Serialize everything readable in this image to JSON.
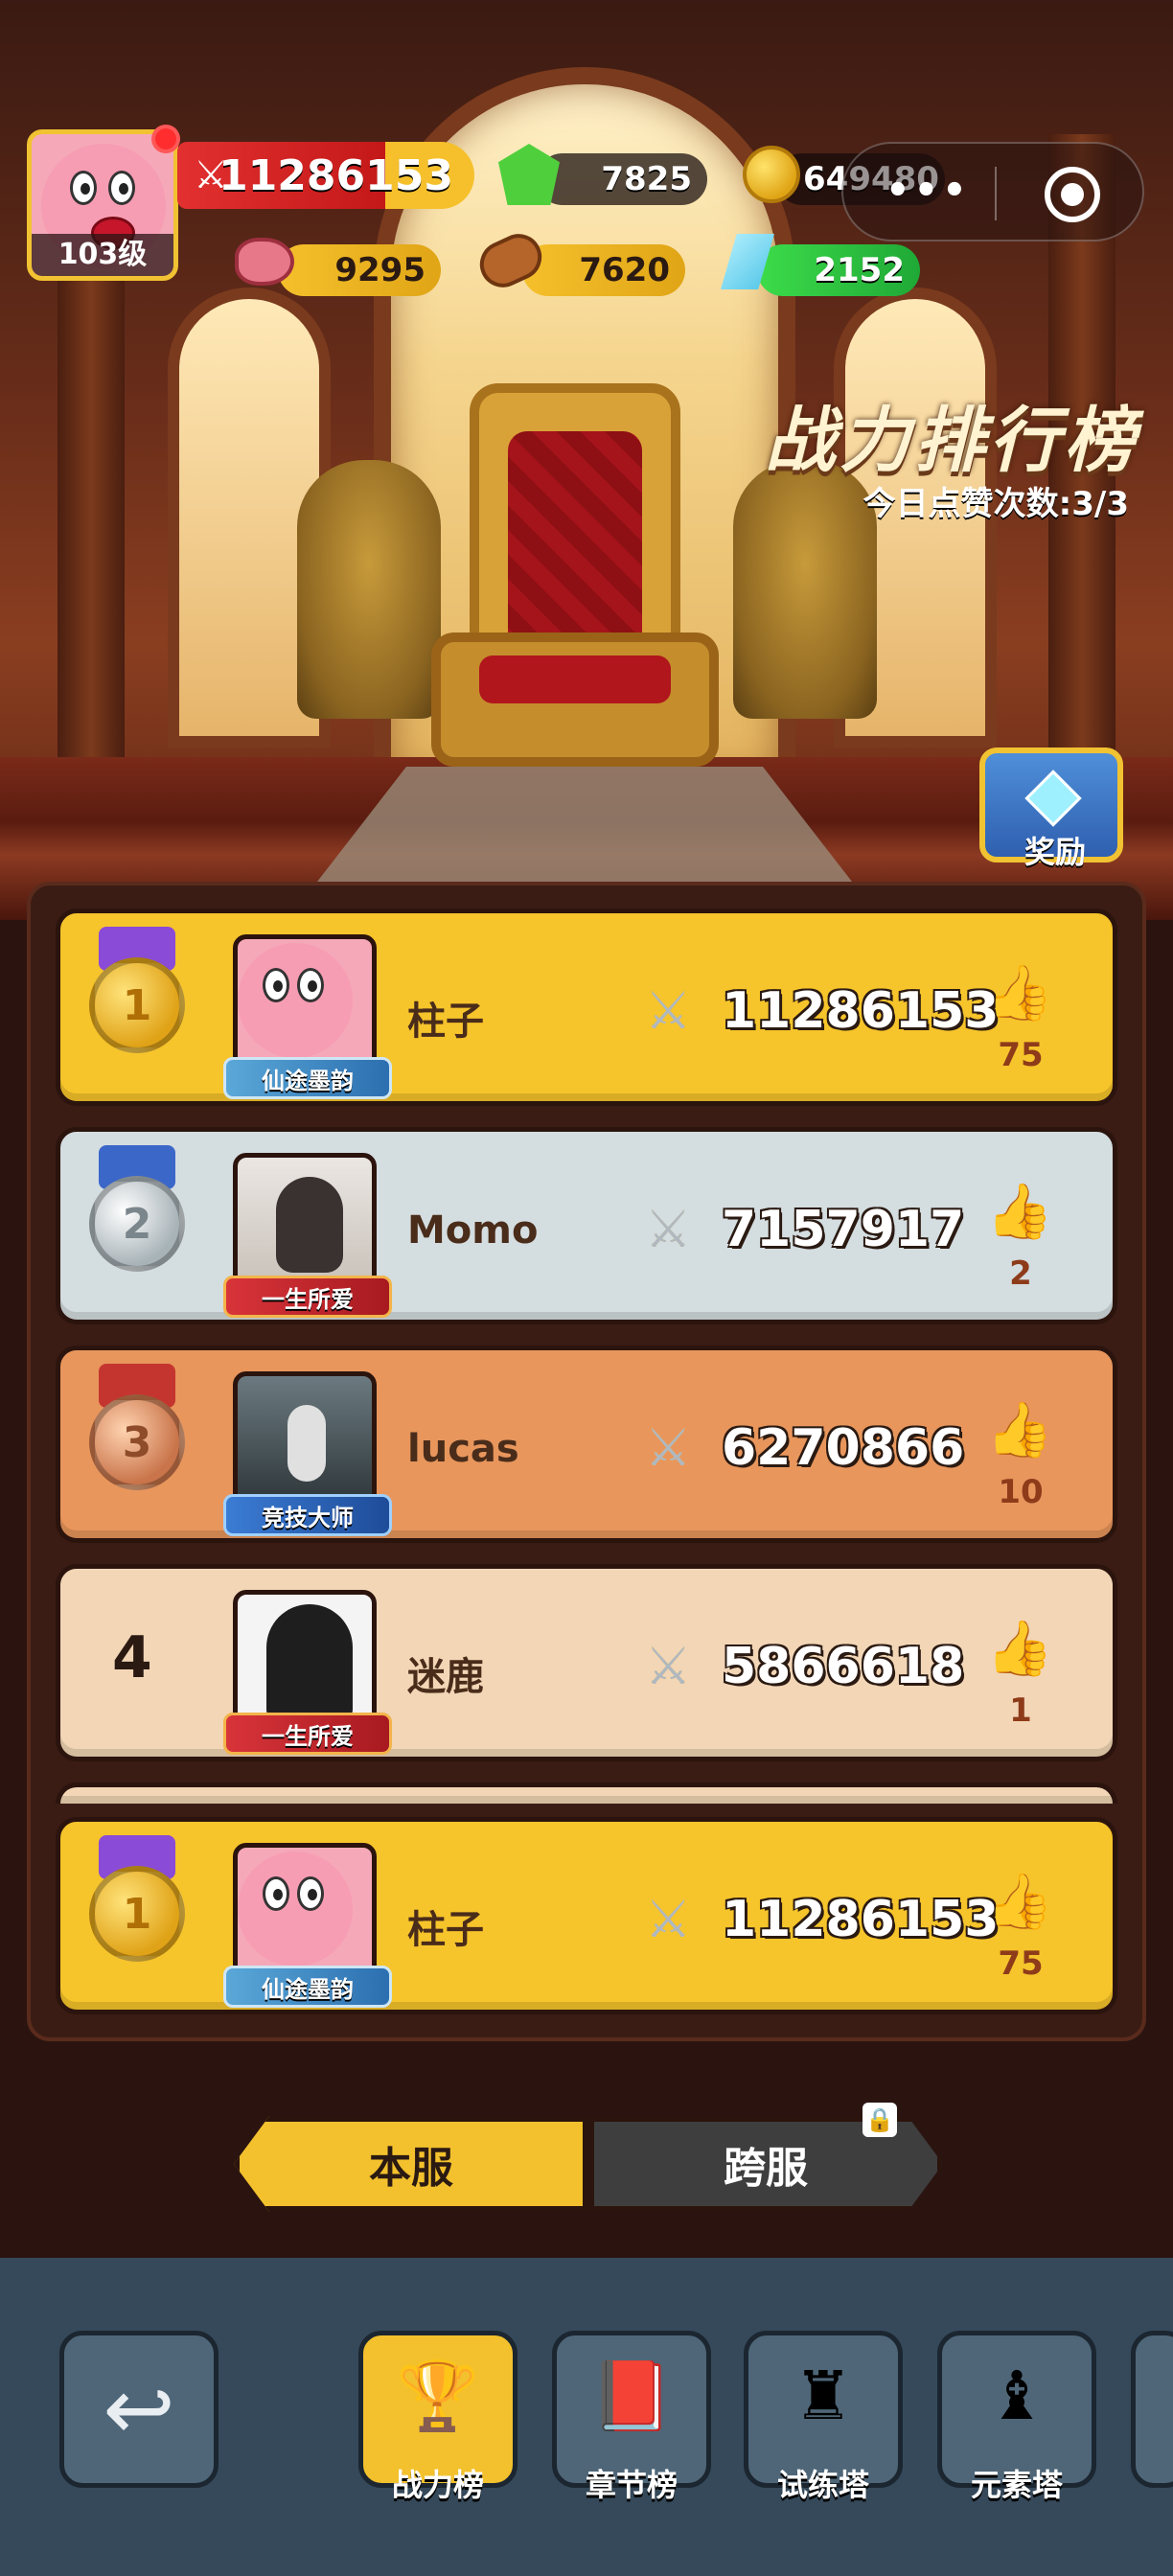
{
  "player": {
    "level_label": "103级",
    "power": "11286153",
    "gems": "7825",
    "coins": "649480",
    "meat": "9295",
    "wood": "7620",
    "crystal": "2152"
  },
  "capsule": {
    "more_label": "•••"
  },
  "board": {
    "title": "战力排行榜",
    "likes_today": "今日点赞次数:3/3",
    "reward_label": "奖励"
  },
  "rankings": [
    {
      "rank": "1",
      "name": "柱子",
      "badge": "仙途墨韵",
      "score": "11286153",
      "likes": "75"
    },
    {
      "rank": "2",
      "name": "Momo",
      "badge": "一生所爱",
      "score": "7157917",
      "likes": "2"
    },
    {
      "rank": "3",
      "name": "lucas",
      "badge": "竞技大师",
      "score": "6270866",
      "likes": "10"
    },
    {
      "rank": "4",
      "name": "迷鹿",
      "badge": "一生所爱",
      "score": "5866618",
      "likes": "1"
    }
  ],
  "self_row": {
    "rank": "1",
    "name": "柱子",
    "badge": "仙途墨韵",
    "score": "11286153",
    "likes": "75"
  },
  "tabs": {
    "local": "本服",
    "cross": "跨服"
  },
  "nav": {
    "power_rank": "战力榜",
    "chapter_rank": "章节榜",
    "trial_tower": "试练塔",
    "element_tower": "元素塔"
  },
  "icons": {
    "back": "back-arrow-icon",
    "trophy": "trophy-icon",
    "book": "book-icon",
    "tower": "tower-icon",
    "chess": "chess-tower-icon"
  },
  "colors": {
    "gold_row": "#f6c42b",
    "silver_row": "#d4dde0",
    "bronze_row": "#e8965c",
    "plain_row": "#f2d6b6"
  }
}
